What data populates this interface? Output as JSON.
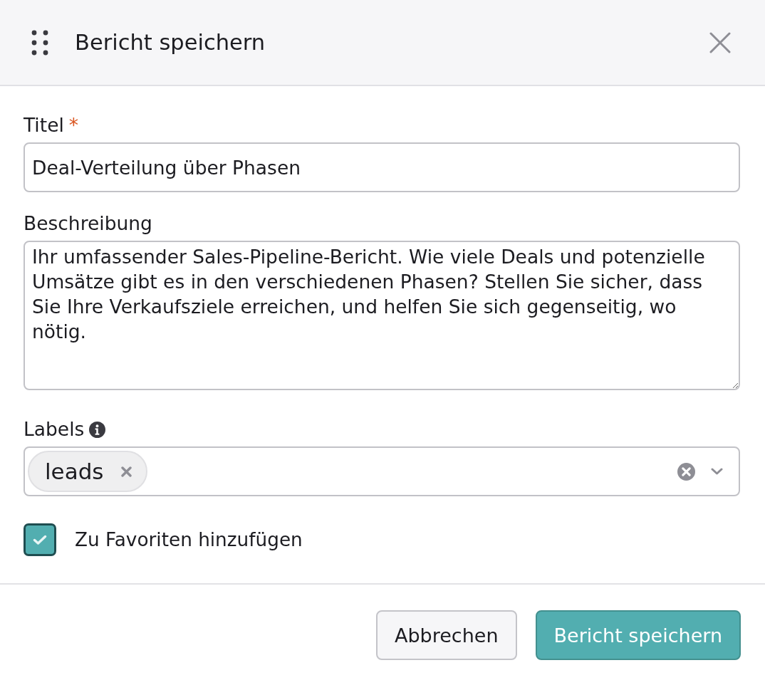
{
  "dialog": {
    "title": "Bericht speichern"
  },
  "fields": [
    {
      "kind": "text",
      "label": "Titel",
      "required_mark": "*",
      "value": "Deal-Verteilung über Phasen"
    },
    {
      "kind": "textarea",
      "label": "Beschreibung",
      "value": "Ihr umfassender Sales-Pipeline-Bericht. Wie viele Deals und potenzielle Umsätze gibt es in den verschiedenen Phasen? Stellen Sie sicher, dass Sie Ihre Verkaufsziele erreichen, und helfen Sie sich gegenseitig, wo nötig."
    },
    {
      "kind": "tags",
      "label": "Labels",
      "info_icon": true,
      "tags": [
        {
          "label": "leads"
        }
      ]
    }
  ],
  "favorite": {
    "label": "Zu Favoriten hinzufügen",
    "checked": true
  },
  "buttons": [
    {
      "kind": "secondary",
      "label": "Abbrechen"
    },
    {
      "kind": "primary",
      "label": "Bericht speichern"
    }
  ]
}
